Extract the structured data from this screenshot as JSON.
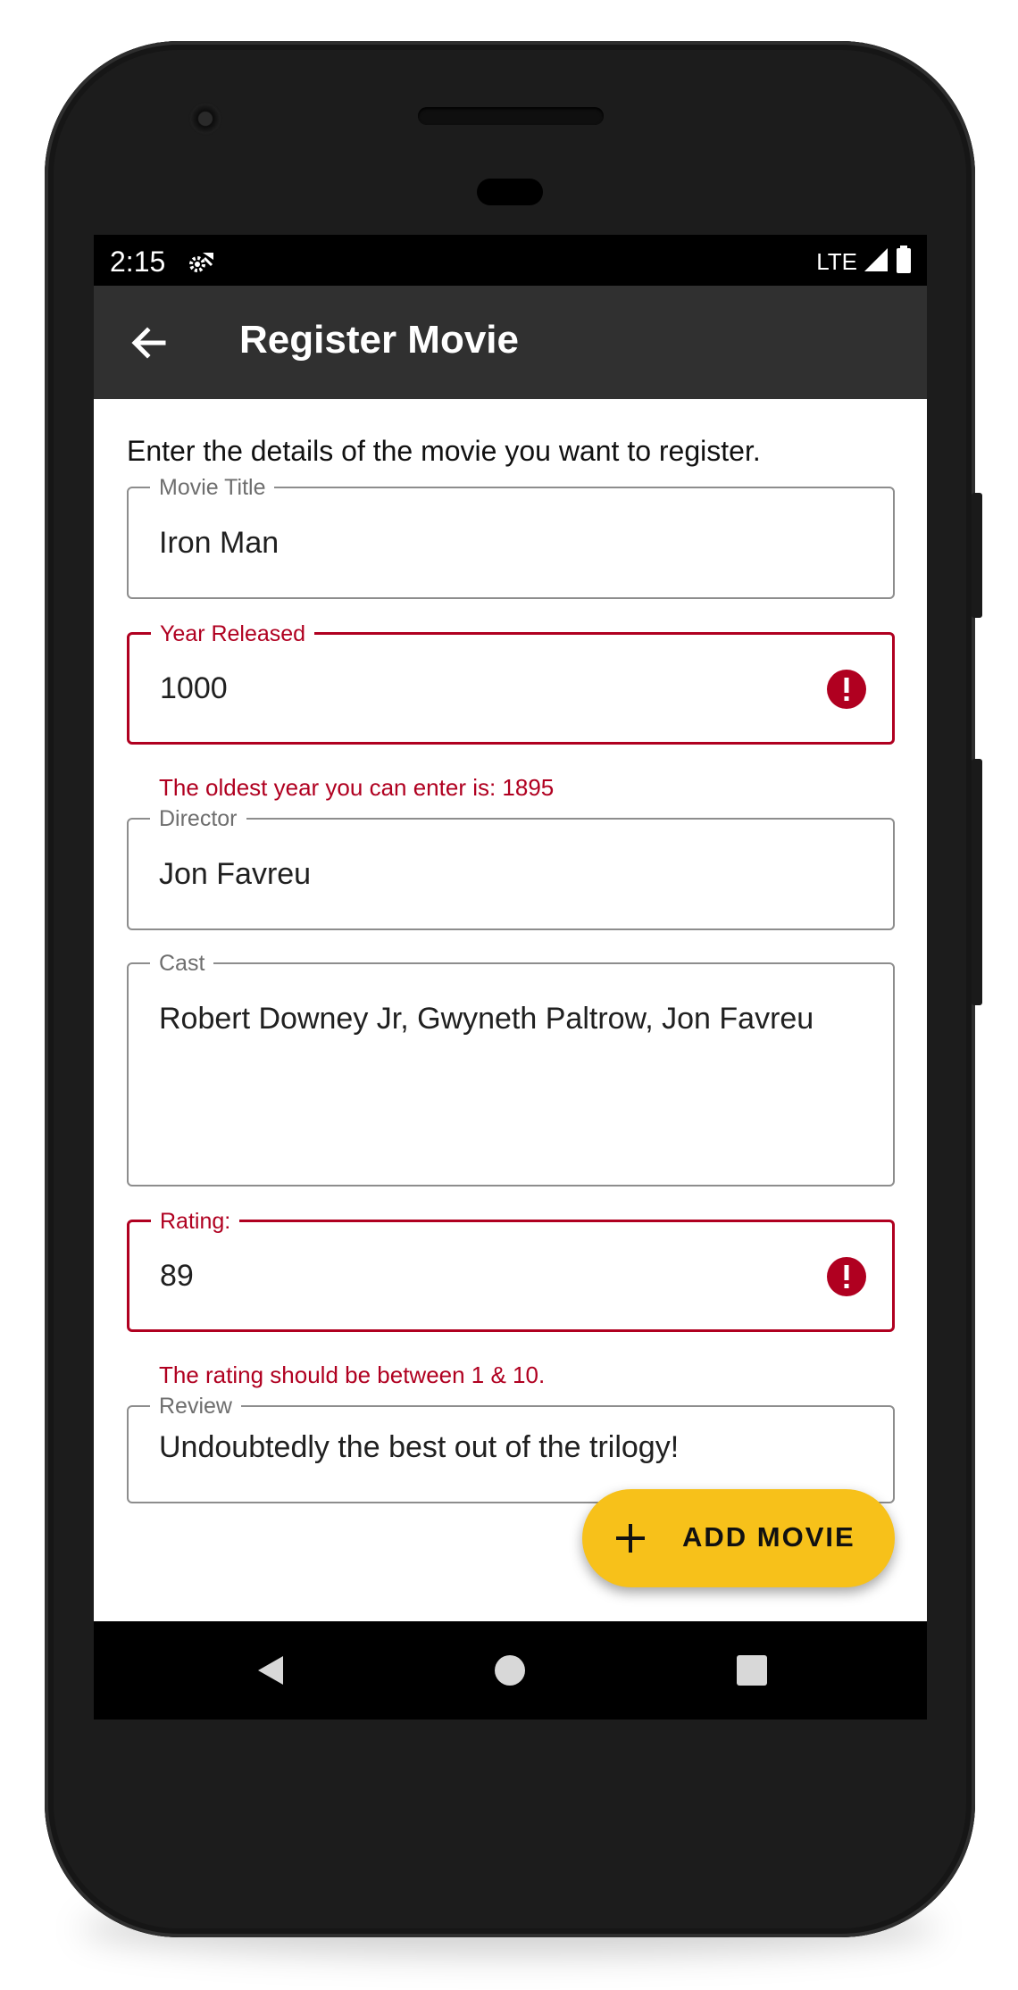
{
  "status_bar": {
    "time": "2:15",
    "network": "LTE"
  },
  "app_bar": {
    "title": "Register Movie"
  },
  "form": {
    "intro": "Enter the details of the movie you want to register.",
    "movie_title": {
      "label": "Movie Title",
      "value": "Iron Man"
    },
    "year_released": {
      "label": "Year Released",
      "value": "1000",
      "error": "The oldest year you can enter is: 1895"
    },
    "director": {
      "label": "Director",
      "value": "Jon Favreu"
    },
    "cast": {
      "label": "Cast",
      "value": "Robert Downey Jr, Gwyneth Paltrow, Jon Favreu"
    },
    "rating": {
      "label": "Rating:",
      "value": "89",
      "error": "The rating should be between 1 & 10."
    },
    "review": {
      "label": "Review",
      "value": "Undoubtedly the best out of the trilogy!"
    }
  },
  "fab": {
    "label": "ADD MOVIE"
  },
  "colors": {
    "error": "#b00020",
    "fab": "#f7c11a",
    "app_bar": "#303030"
  },
  "icons": {
    "back": "arrow-back-icon",
    "error": "error-icon",
    "add": "plus-icon",
    "nav_back": "triangle-back-icon",
    "nav_home": "circle-home-icon",
    "nav_recent": "square-recent-icon"
  }
}
